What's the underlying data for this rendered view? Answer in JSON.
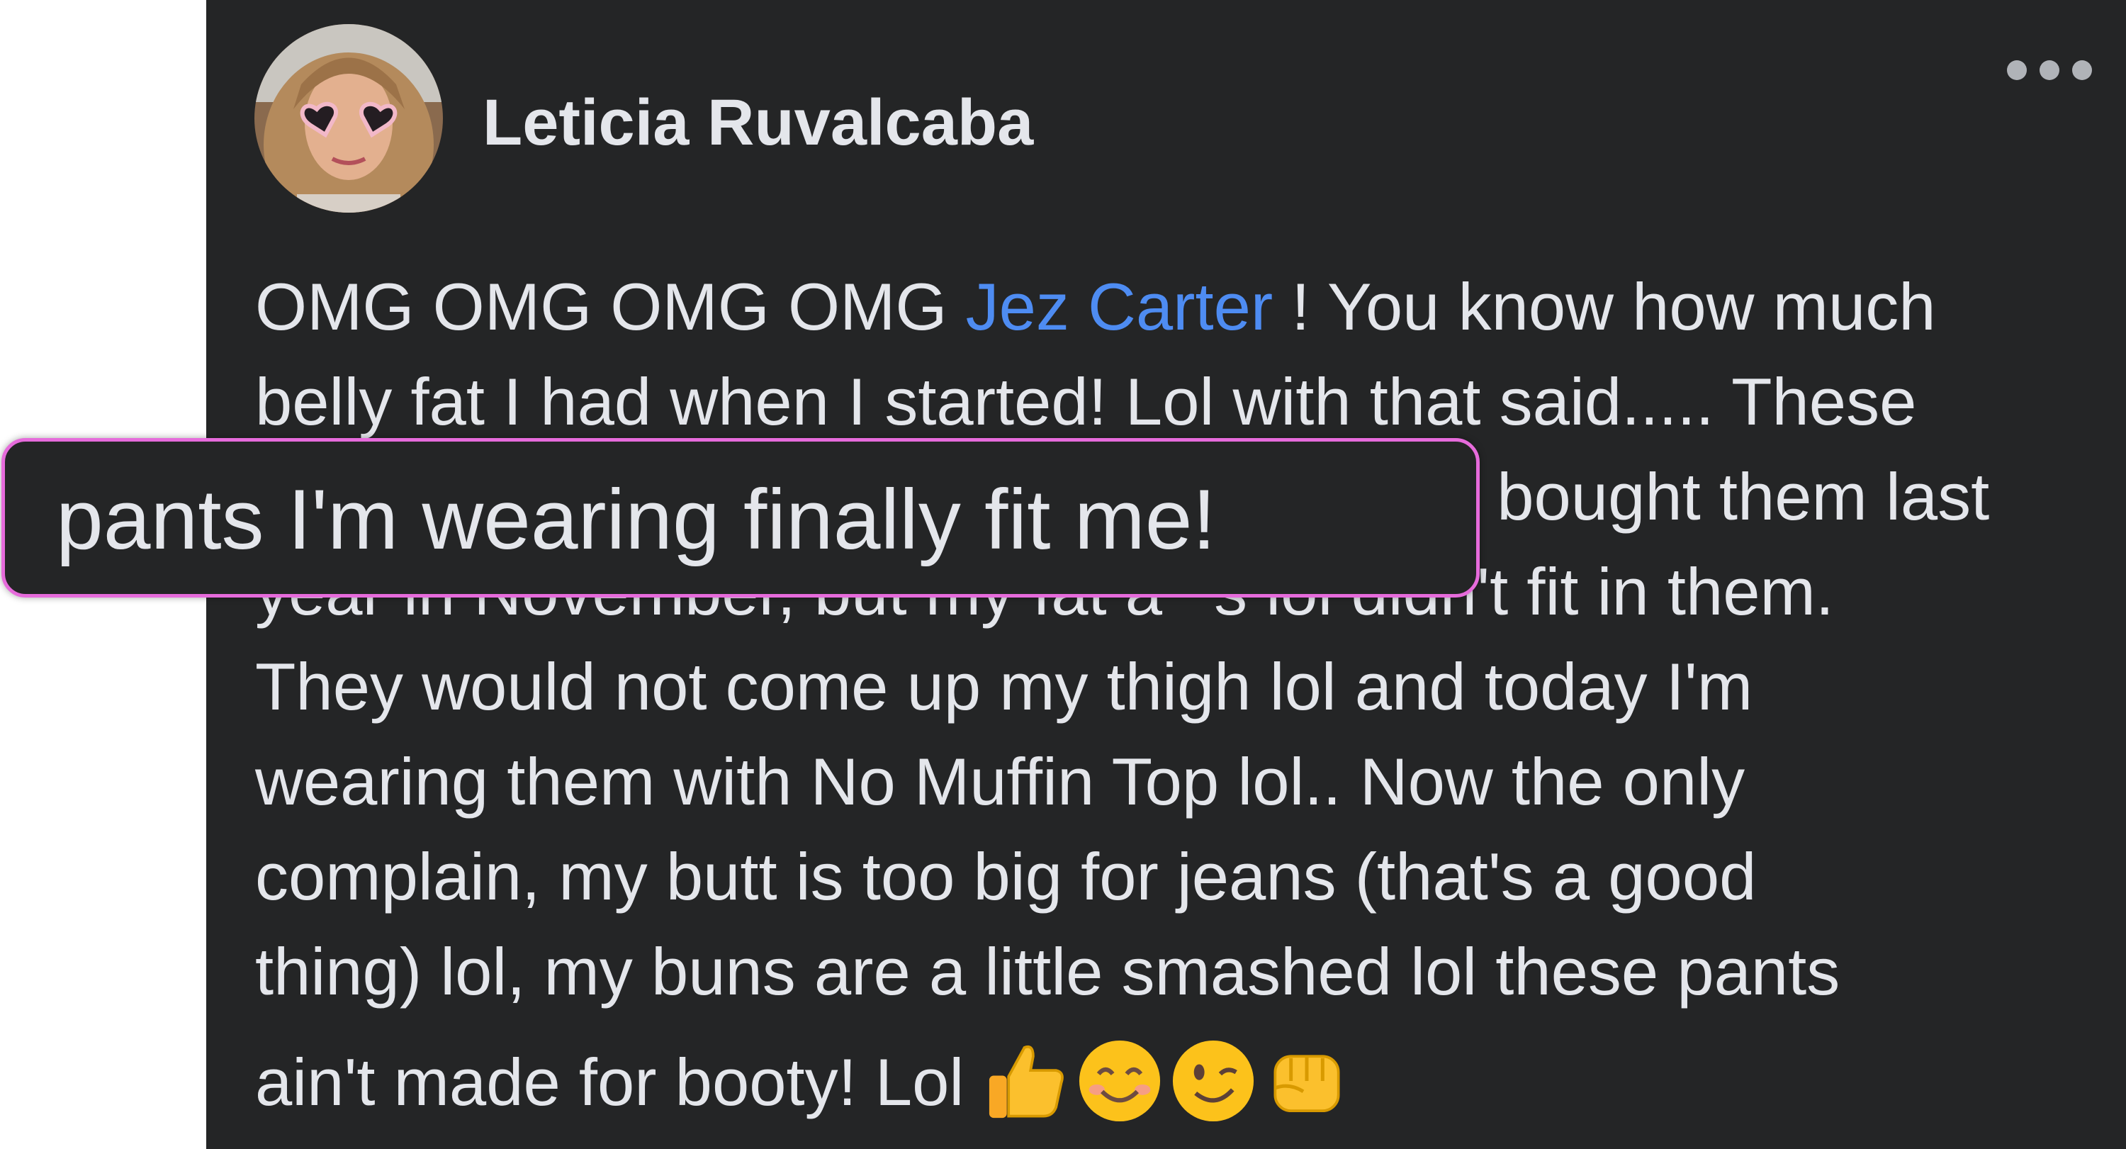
{
  "post": {
    "author": "Leticia Ruvalcaba",
    "more_icon": "more-horizontal-icon",
    "body": {
      "line1_before": "OMG OMG OMG OMG ",
      "mention": "Jez Carter",
      "line1_after": " ! You know how much",
      "line2": "belly fat I had when I started! Lol with that said..... These",
      "line3_visible": "I bought them last",
      "line4": "year in November, but my fat a**s lol didn't fit in them.",
      "line5": "They would not come up my thigh lol and today I'm",
      "line6": "wearing them with No Muffin Top lol.. Now the only",
      "line7": "complain, my butt is too big for jeans (that's a good",
      "line8": "thing) lol, my buns are a little smashed lol these pants",
      "line9": "ain't made for booty! Lol "
    },
    "emojis": [
      "thumbs-up-emoji",
      "smiling-face-emoji",
      "winking-face-emoji",
      "fist-bump-emoji"
    ]
  },
  "callout": {
    "text": "pants I'm wearing finally fit me!",
    "border_color": "#e66bdb"
  },
  "colors": {
    "post_background": "#242526",
    "text": "#e4e6eb",
    "mention": "#4e8cf2",
    "page_background": "#ffffff"
  }
}
